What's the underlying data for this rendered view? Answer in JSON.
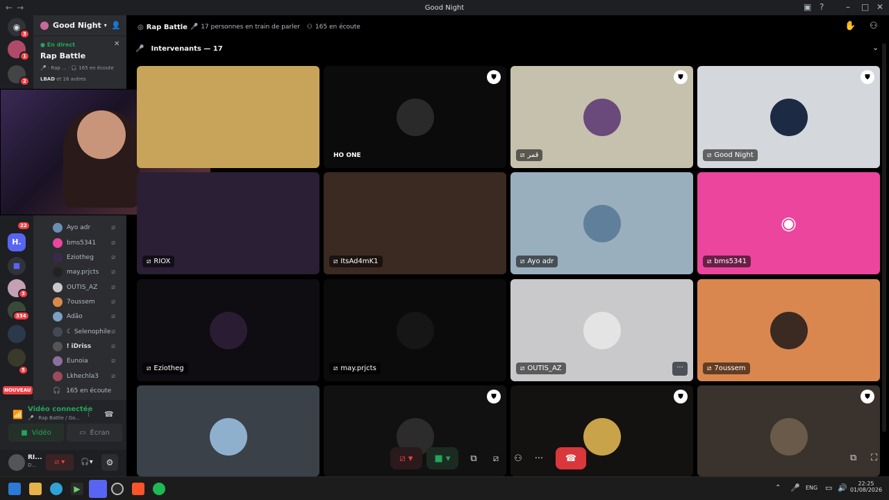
{
  "window": {
    "title": "Good Night",
    "nav_back": "←",
    "nav_fwd": "→"
  },
  "rail": {
    "badges": [
      "3",
      "1",
      "2",
      "22",
      "3",
      "334",
      "5"
    ],
    "new_label": "NOUVEAU"
  },
  "sidebar": {
    "server_name": "Good Night",
    "live_label": "En direct",
    "stage_name": "Rap Battle",
    "stage_meta": "🎤 · Rap ... · 🎧 165 en écoute",
    "stage_lead": "LBAD",
    "stage_lead_rest": "et 16 autres",
    "members": [
      {
        "name": "Ayo adr",
        "color": "#6b8fb3"
      },
      {
        "name": "bms5341",
        "color": "#eb459e"
      },
      {
        "name": "Eziotheg",
        "color": "#3a2a4a"
      },
      {
        "name": "may.prjcts",
        "color": "#222222"
      },
      {
        "name": "OUTIS_AZ",
        "color": "#c9c9c9"
      },
      {
        "name": "7oussem",
        "color": "#d98a4a"
      },
      {
        "name": "Adão",
        "color": "#7aa0c4"
      },
      {
        "name": "☾ Selenophile",
        "color": "#444a55"
      },
      {
        "name": "ǃ iDriss",
        "color": "#555555"
      },
      {
        "name": "Eunoia",
        "color": "#8b6f9e"
      },
      {
        "name": "Lkhechla3",
        "color": "#9e4a5a"
      }
    ],
    "listeners": "165 en écoute"
  },
  "voice_panel": {
    "status": "Vidéo connectée",
    "channel": "🎤 · Rap Battle / Go...",
    "video_btn": "Vidéo",
    "screen_btn": "Écran",
    "user_name": "RI...",
    "user_sub": "D..."
  },
  "topbar": {
    "stage_title": "Rap Battle",
    "speakers": "17 personnes en train de parler",
    "listeners": "165 en écoute",
    "section_title": "Intervenants — 17"
  },
  "tiles": [
    {
      "name": "",
      "bg": "#c8a45a",
      "avatar": "",
      "shield": false
    },
    {
      "name": "HO ONE",
      "bg": "#0b0b0b",
      "avatar": "#2a2a2a",
      "shield": true,
      "plain": true
    },
    {
      "name": "قمر",
      "bg": "#c5c1ad",
      "avatar": "#6a4a7a",
      "shield": true
    },
    {
      "name": "Good Night",
      "bg": "#d4d8dc",
      "avatar": "#1d2a44",
      "shield": true
    },
    {
      "name": "RIOX",
      "bg": "#2b1f35",
      "avatar": "",
      "shield": false
    },
    {
      "name": "ItsAd4mK1",
      "bg": "#3b2a22",
      "avatar": "",
      "shield": false
    },
    {
      "name": "Ayo adr",
      "bg": "#9aafbd",
      "avatar": "#5f7f9b",
      "shield": false
    },
    {
      "name": "bms5341",
      "bg": "#eb459e",
      "avatar": "",
      "shield": false,
      "discord": true
    },
    {
      "name": "Eziotheg",
      "bg": "#0f0c12",
      "avatar": "#2a1d33",
      "shield": false
    },
    {
      "name": "may.prjcts",
      "bg": "#0b0b0b",
      "avatar": "#161616",
      "shield": false
    },
    {
      "name": "OUTIS_AZ",
      "bg": "#c9c9cb",
      "avatar": "#e4e4e4",
      "shield": false,
      "more": true
    },
    {
      "name": "7oussem",
      "bg": "#d9874f",
      "avatar": "#3a2a22",
      "shield": false
    },
    {
      "name": "",
      "bg": "#3b4148",
      "avatar": "#8fb0cc",
      "shield": false
    },
    {
      "name": "",
      "bg": "#111111",
      "avatar": "#2c2c2c",
      "shield": true
    },
    {
      "name": "",
      "bg": "#141210",
      "avatar": "#c9a34a",
      "shield": true
    },
    {
      "name": "",
      "bg": "#3a322c",
      "avatar": "#6a5a4a",
      "shield": true
    }
  ],
  "clock": {
    "time": "22:25",
    "date": "01/08/2026",
    "lang": "ENG"
  },
  "colors": {
    "accent": "#5865f2",
    "danger": "#da373c",
    "online": "#23a55a"
  }
}
